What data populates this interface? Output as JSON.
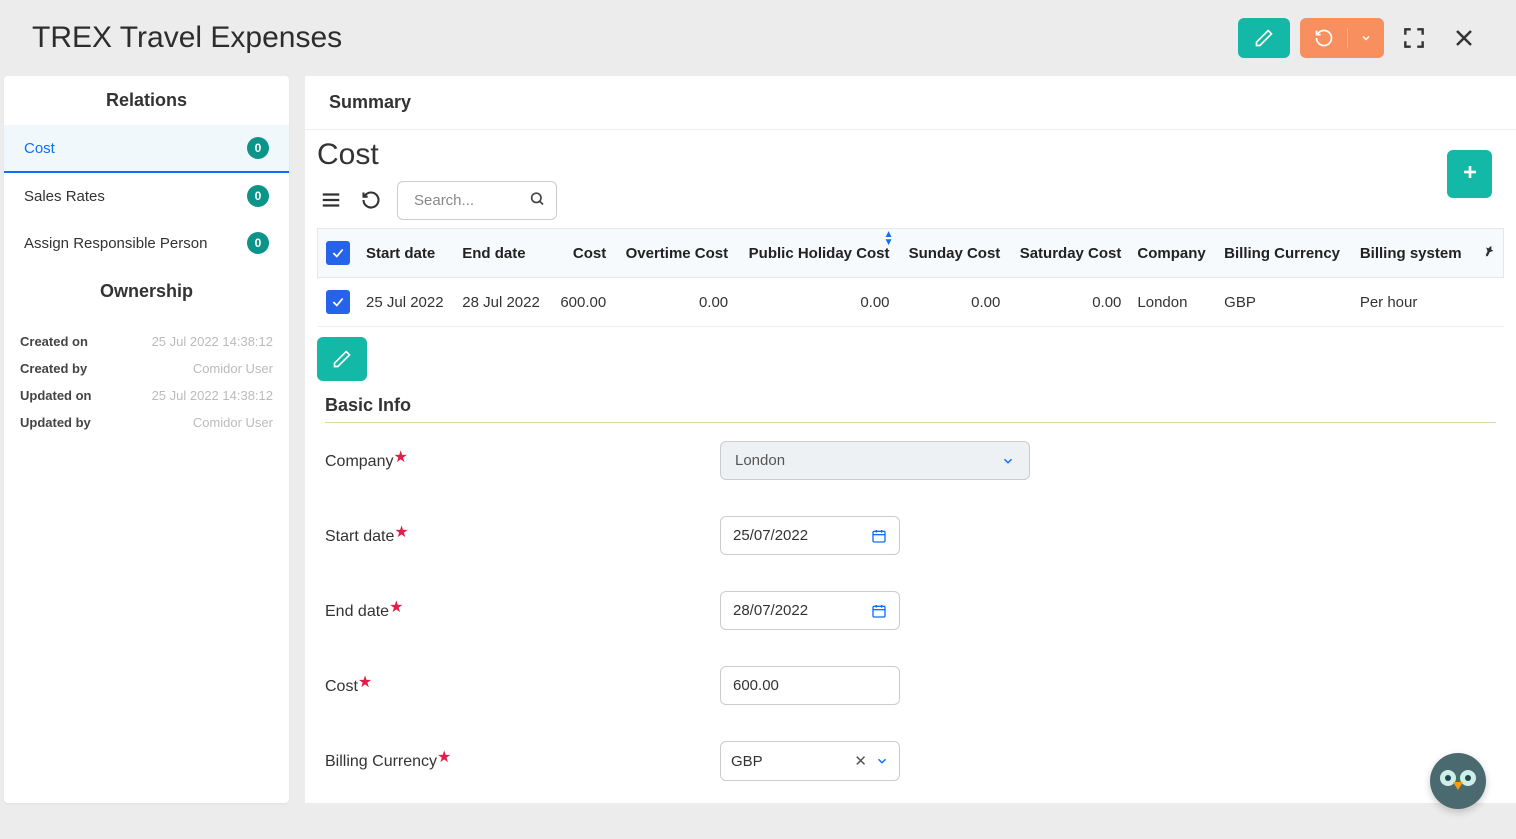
{
  "header": {
    "title": "TREX Travel Expenses"
  },
  "sidebar": {
    "relations_title": "Relations",
    "items": [
      {
        "label": "Cost",
        "count": "0"
      },
      {
        "label": "Sales Rates",
        "count": "0"
      },
      {
        "label": "Assign Responsible Person",
        "count": "0"
      }
    ],
    "ownership_title": "Ownership",
    "ownership": {
      "created_on_label": "Created on",
      "created_on_value": "25 Jul 2022 14:38:12",
      "created_by_label": "Created by",
      "created_by_value": "Comidor User",
      "updated_on_label": "Updated on",
      "updated_on_value": "25 Jul 2022 14:38:12",
      "updated_by_label": "Updated by",
      "updated_by_value": "Comidor User"
    }
  },
  "main": {
    "summary_tab": "Summary",
    "section_title": "Cost",
    "search_placeholder": "Search...",
    "columns": {
      "start_date": "Start date",
      "end_date": "End date",
      "cost": "Cost",
      "overtime": "Overtime Cost",
      "public_holiday": "Public Holiday Cost",
      "sunday": "Sunday Cost",
      "saturday": "Saturday Cost",
      "company": "Company",
      "billing_currency": "Billing Currency",
      "billing_system": "Billing system"
    },
    "rows": [
      {
        "start_date": "25 Jul 2022",
        "end_date": "28 Jul 2022",
        "cost": "600.00",
        "overtime": "0.00",
        "public_holiday": "0.00",
        "sunday": "0.00",
        "saturday": "0.00",
        "company": "London",
        "billing_currency": "GBP",
        "billing_system": "Per hour"
      }
    ],
    "basic_info_title": "Basic Info",
    "form": {
      "company_label": "Company",
      "company_value": "London",
      "start_date_label": "Start date",
      "start_date_value": "25/07/2022",
      "end_date_label": "End date",
      "end_date_value": "28/07/2022",
      "cost_label": "Cost",
      "cost_value": "600.00",
      "billing_currency_label": "Billing Currency",
      "billing_currency_value": "GBP"
    }
  }
}
